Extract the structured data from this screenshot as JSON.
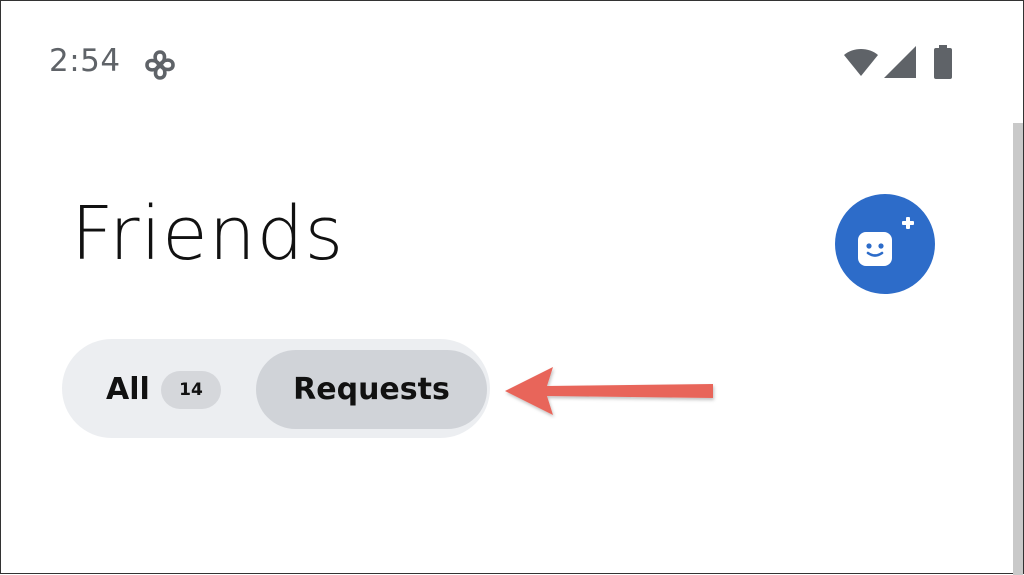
{
  "status_bar": {
    "time": "2:54",
    "icons": [
      "pinwheel-icon",
      "wifi-icon",
      "signal-icon",
      "battery-icon"
    ]
  },
  "header": {
    "title": "Friends",
    "add_friend_icon": "add-friend-icon"
  },
  "tabs": {
    "all": {
      "label": "All",
      "count": "14"
    },
    "requests": {
      "label": "Requests",
      "selected": true
    }
  },
  "colors": {
    "accent": "#2d6cc9",
    "annotation_arrow": "#e8655a",
    "segment_bg": "#eceef1",
    "segment_selected": "#d0d3d8",
    "status_icon": "#5f6368"
  }
}
